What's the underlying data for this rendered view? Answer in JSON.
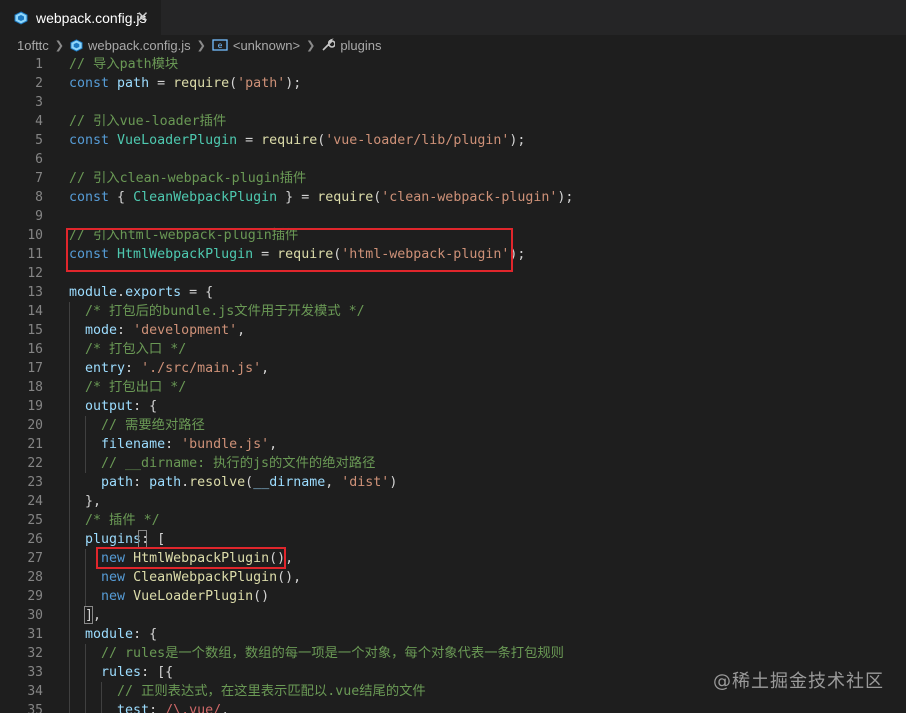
{
  "tab": {
    "title": "webpack.config.js",
    "close": "✕",
    "icon": "webpack-cube-icon"
  },
  "breadcrumb": {
    "folder": "1ofttc",
    "file": "webpack.config.js",
    "symbol": "<unknown>",
    "plugins": "plugins"
  },
  "colors": {
    "comment": "#6a9955",
    "keyword": "#569cd6",
    "variable": "#9cdcfe",
    "function": "#dcdcaa",
    "string": "#ce9178",
    "class": "#4ec9b0",
    "highlight_box": "#e0262c"
  },
  "lines": [
    {
      "n": "1",
      "tokens": [
        [
          "com",
          "// 导入path模块"
        ]
      ]
    },
    {
      "n": "2",
      "tokens": [
        [
          "kw",
          "const "
        ],
        [
          "var",
          "path"
        ],
        [
          "pun",
          " = "
        ],
        [
          "fn",
          "require"
        ],
        [
          "pun",
          "("
        ],
        [
          "str",
          "'path'"
        ],
        [
          "pun",
          ");"
        ]
      ]
    },
    {
      "n": "3",
      "tokens": []
    },
    {
      "n": "4",
      "tokens": [
        [
          "com",
          "// 引入vue-loader插件"
        ]
      ]
    },
    {
      "n": "5",
      "tokens": [
        [
          "kw",
          "const "
        ],
        [
          "cls",
          "VueLoaderPlugin"
        ],
        [
          "pun",
          " = "
        ],
        [
          "fn",
          "require"
        ],
        [
          "pun",
          "("
        ],
        [
          "str",
          "'vue-loader/lib/plugin'"
        ],
        [
          "pun",
          ");"
        ]
      ]
    },
    {
      "n": "6",
      "tokens": []
    },
    {
      "n": "7",
      "tokens": [
        [
          "com",
          "// 引入clean-webpack-plugin插件"
        ]
      ]
    },
    {
      "n": "8",
      "tokens": [
        [
          "kw",
          "const "
        ],
        [
          "pun",
          "{ "
        ],
        [
          "cls",
          "CleanWebpackPlugin"
        ],
        [
          "pun",
          " } = "
        ],
        [
          "fn",
          "require"
        ],
        [
          "pun",
          "("
        ],
        [
          "str",
          "'clean-webpack-plugin'"
        ],
        [
          "pun",
          ");"
        ]
      ]
    },
    {
      "n": "9",
      "tokens": []
    },
    {
      "n": "10",
      "tokens": [
        [
          "com",
          "// 引入html-webpack-plugin插件"
        ]
      ]
    },
    {
      "n": "11",
      "tokens": [
        [
          "kw",
          "const "
        ],
        [
          "cls",
          "HtmlWebpackPlugin"
        ],
        [
          "pun",
          " = "
        ],
        [
          "fn",
          "require"
        ],
        [
          "pun",
          "("
        ],
        [
          "str",
          "'html-webpack-plugin'"
        ],
        [
          "pun",
          ");"
        ]
      ]
    },
    {
      "n": "12",
      "tokens": []
    },
    {
      "n": "13",
      "tokens": [
        [
          "var",
          "module"
        ],
        [
          "pun",
          "."
        ],
        [
          "var",
          "exports"
        ],
        [
          "pun",
          " = {"
        ]
      ]
    },
    {
      "n": "14",
      "tokens": [
        [
          "pun",
          "  "
        ],
        [
          "com",
          "/* 打包后的bundle.js文件用于开发模式 */"
        ]
      ]
    },
    {
      "n": "15",
      "tokens": [
        [
          "pun",
          "  "
        ],
        [
          "prop",
          "mode"
        ],
        [
          "pun",
          ": "
        ],
        [
          "str",
          "'development'"
        ],
        [
          "pun",
          ","
        ]
      ]
    },
    {
      "n": "16",
      "tokens": [
        [
          "pun",
          "  "
        ],
        [
          "com",
          "/* 打包入口 */"
        ]
      ]
    },
    {
      "n": "17",
      "tokens": [
        [
          "pun",
          "  "
        ],
        [
          "prop",
          "entry"
        ],
        [
          "pun",
          ": "
        ],
        [
          "str",
          "'./src/main.js'"
        ],
        [
          "pun",
          ","
        ]
      ]
    },
    {
      "n": "18",
      "tokens": [
        [
          "pun",
          "  "
        ],
        [
          "com",
          "/* 打包出口 */"
        ]
      ]
    },
    {
      "n": "19",
      "tokens": [
        [
          "pun",
          "  "
        ],
        [
          "prop",
          "output"
        ],
        [
          "pun",
          ": {"
        ]
      ]
    },
    {
      "n": "20",
      "tokens": [
        [
          "pun",
          "    "
        ],
        [
          "com",
          "// 需要绝对路径"
        ]
      ]
    },
    {
      "n": "21",
      "tokens": [
        [
          "pun",
          "    "
        ],
        [
          "prop",
          "filename"
        ],
        [
          "pun",
          ": "
        ],
        [
          "str",
          "'bundle.js'"
        ],
        [
          "pun",
          ","
        ]
      ]
    },
    {
      "n": "22",
      "tokens": [
        [
          "pun",
          "    "
        ],
        [
          "com",
          "// __dirname: 执行的js的文件的绝对路径"
        ]
      ]
    },
    {
      "n": "23",
      "tokens": [
        [
          "pun",
          "    "
        ],
        [
          "prop",
          "path"
        ],
        [
          "pun",
          ": "
        ],
        [
          "var",
          "path"
        ],
        [
          "pun",
          "."
        ],
        [
          "fn",
          "resolve"
        ],
        [
          "pun",
          "("
        ],
        [
          "var",
          "__dirname"
        ],
        [
          "pun",
          ", "
        ],
        [
          "str",
          "'dist'"
        ],
        [
          "pun",
          ")"
        ]
      ]
    },
    {
      "n": "24",
      "tokens": [
        [
          "pun",
          "  },"
        ]
      ]
    },
    {
      "n": "25",
      "tokens": [
        [
          "pun",
          "  "
        ],
        [
          "com",
          "/* 插件 */"
        ]
      ]
    },
    {
      "n": "26",
      "tokens": [
        [
          "pun",
          "  "
        ],
        [
          "prop",
          "plugins"
        ],
        [
          "pun",
          ": ["
        ]
      ]
    },
    {
      "n": "27",
      "tokens": [
        [
          "pun",
          "    "
        ],
        [
          "kw",
          "new "
        ],
        [
          "fn",
          "HtmlWebpackPlugin"
        ],
        [
          "pun",
          "(),"
        ]
      ]
    },
    {
      "n": "28",
      "tokens": [
        [
          "pun",
          "    "
        ],
        [
          "kw",
          "new "
        ],
        [
          "fn",
          "CleanWebpackPlugin"
        ],
        [
          "pun",
          "(),"
        ]
      ]
    },
    {
      "n": "29",
      "tokens": [
        [
          "pun",
          "    "
        ],
        [
          "kw",
          "new "
        ],
        [
          "fn",
          "VueLoaderPlugin"
        ],
        [
          "pun",
          "()"
        ]
      ]
    },
    {
      "n": "30",
      "tokens": [
        [
          "pun",
          "  ],"
        ]
      ]
    },
    {
      "n": "31",
      "tokens": [
        [
          "pun",
          "  "
        ],
        [
          "prop",
          "module"
        ],
        [
          "pun",
          ": {"
        ]
      ]
    },
    {
      "n": "32",
      "tokens": [
        [
          "pun",
          "    "
        ],
        [
          "com",
          "// rules是一个数组，数组的每一项是一个对象，每个对象代表一条打包规则"
        ]
      ]
    },
    {
      "n": "33",
      "tokens": [
        [
          "pun",
          "    "
        ],
        [
          "prop",
          "rules"
        ],
        [
          "pun",
          ": [{"
        ]
      ]
    },
    {
      "n": "34",
      "tokens": [
        [
          "pun",
          "      "
        ],
        [
          "com",
          "// 正则表达式，在这里表示匹配以.vue结尾的文件"
        ]
      ]
    },
    {
      "n": "35",
      "tokens": [
        [
          "pun",
          "      "
        ],
        [
          "prop",
          "test"
        ],
        [
          "pun",
          ": "
        ],
        [
          "rx",
          "/\\.vue/"
        ],
        [
          "pun",
          ","
        ]
      ]
    }
  ],
  "watermark": "@稀土掘金技术社区"
}
